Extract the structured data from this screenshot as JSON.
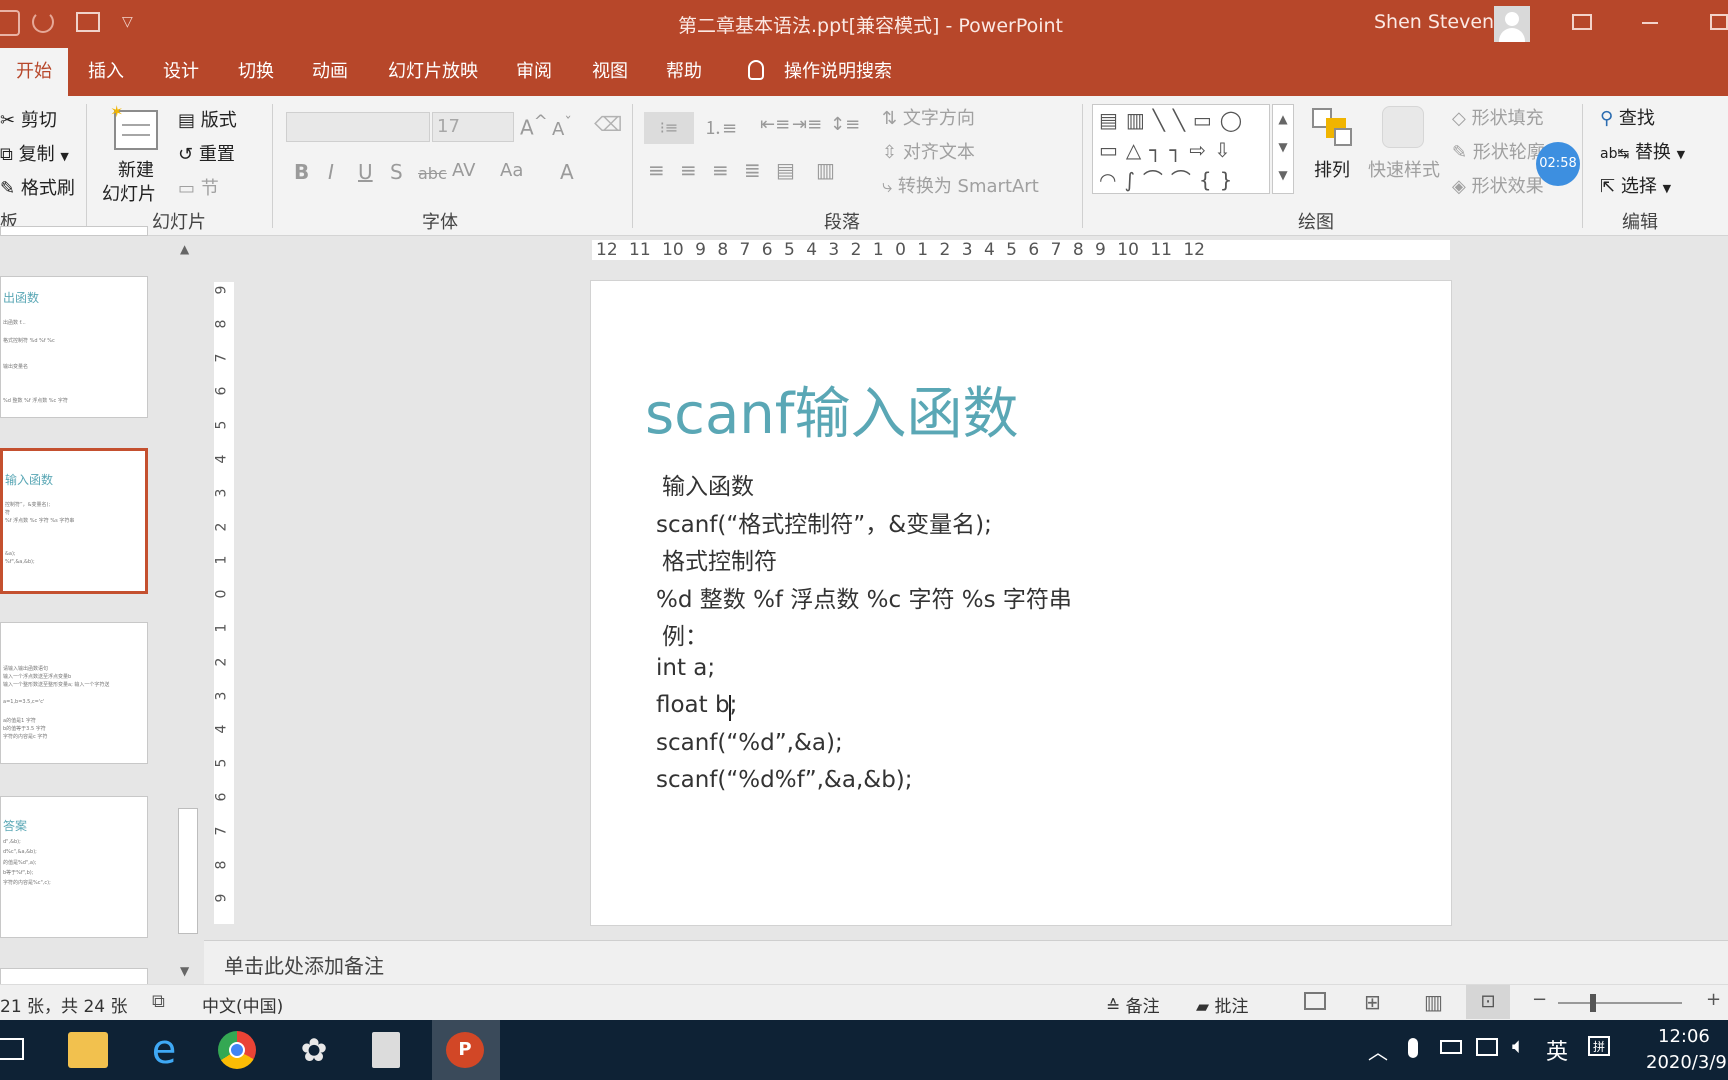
{
  "window": {
    "title": "第二章基本语法.ppt[兼容模式]  -  PowerPoint",
    "user": "Shen Steven"
  },
  "tabs": [
    "开始",
    "插入",
    "设计",
    "切换",
    "动画",
    "幻灯片放映",
    "审阅",
    "视图",
    "帮助"
  ],
  "tell_me": "操作说明搜索",
  "ribbon": {
    "clipboard": {
      "cut": "剪切",
      "copy": "复制",
      "painter": "格式刷",
      "label": "板"
    },
    "slides": {
      "new_slide_1": "新建",
      "new_slide_2": "幻灯片",
      "layout": "版式",
      "reset": "重置",
      "section": "节",
      "label": "幻灯片"
    },
    "font": {
      "size": "17",
      "label": "字体",
      "aa": "Aa"
    },
    "paragraph": {
      "text_direction": "文字方向",
      "align_text": "对齐文本",
      "smartart": "转换为 SmartArt",
      "label": "段落"
    },
    "drawing": {
      "arrange": "排列",
      "quick_styles": "快速样式",
      "fill": "形状填充",
      "outline": "形状轮廓",
      "effects": "形状效果",
      "timer": "02:58",
      "label": "绘图"
    },
    "editing": {
      "find": "查找",
      "replace": "替换",
      "select": "选择",
      "label": "编辑"
    }
  },
  "ruler": {
    "horizontal": "12 11 10 9 8 7 6 5 4 3 2 1 0 1 2 3 4 5 6 7 8 9 10 11 12",
    "vertical": [
      "9",
      "8",
      "7",
      "6",
      "5",
      "4",
      "3",
      "2",
      "1",
      "0",
      "1",
      "2",
      "3",
      "4",
      "5",
      "6",
      "7",
      "8",
      "9"
    ]
  },
  "thumbnails": [
    {
      "title": "出函数",
      "lines": [
        "出函数 f...",
        "格式控制符 %d %f %c",
        "输出变量名",
        "%d 整数 %f 浮点数 %c 字符"
      ]
    },
    {
      "title": "输入函数",
      "lines": [
        "控制符”，&变量名);",
        "符",
        "%f 浮点数 %c 字符 %s 字符串",
        "&a);",
        "%f\",&a,&b);"
      ]
    },
    {
      "title": "",
      "lines": [
        "请输入输出函数语句",
        "输入一个浮点数送至浮点变量b",
        "输入一个整形数送至整形变量a; 输入一个字符送",
        "a=1,b=3.5,c='c'",
        "a的值是1 字符",
        "b的值等于3.5 字符",
        "字符的内容是c 字符"
      ]
    },
    {
      "title": "答案",
      "lines": [
        "d\",&b);",
        "d%c\",&a,&b);",
        "的值是%d\",a);",
        "b等于%f\",b);",
        "字符的内容是%c\",c);"
      ]
    }
  ],
  "slide": {
    "title": "scanf输入函数",
    "body": [
      "输入函数",
      "scanf(“格式控制符”，&变量名);",
      "格式控制符",
      "%d  整数     %f   浮点数    %c   字符     %s   字符串",
      "例：",
      "int a;",
      "float b;",
      "scanf(“%d”,&a);",
      "scanf(“%d%f”,&a,&b);"
    ]
  },
  "notes_placeholder": "单击此处添加备注",
  "status": {
    "slide_count": "21 张，共 24 张",
    "language": "中文(中国)",
    "notes": "备注",
    "comments": "批注"
  },
  "taskbar": {
    "ime": "英",
    "time": "12:06",
    "date": "2020/3/9"
  }
}
